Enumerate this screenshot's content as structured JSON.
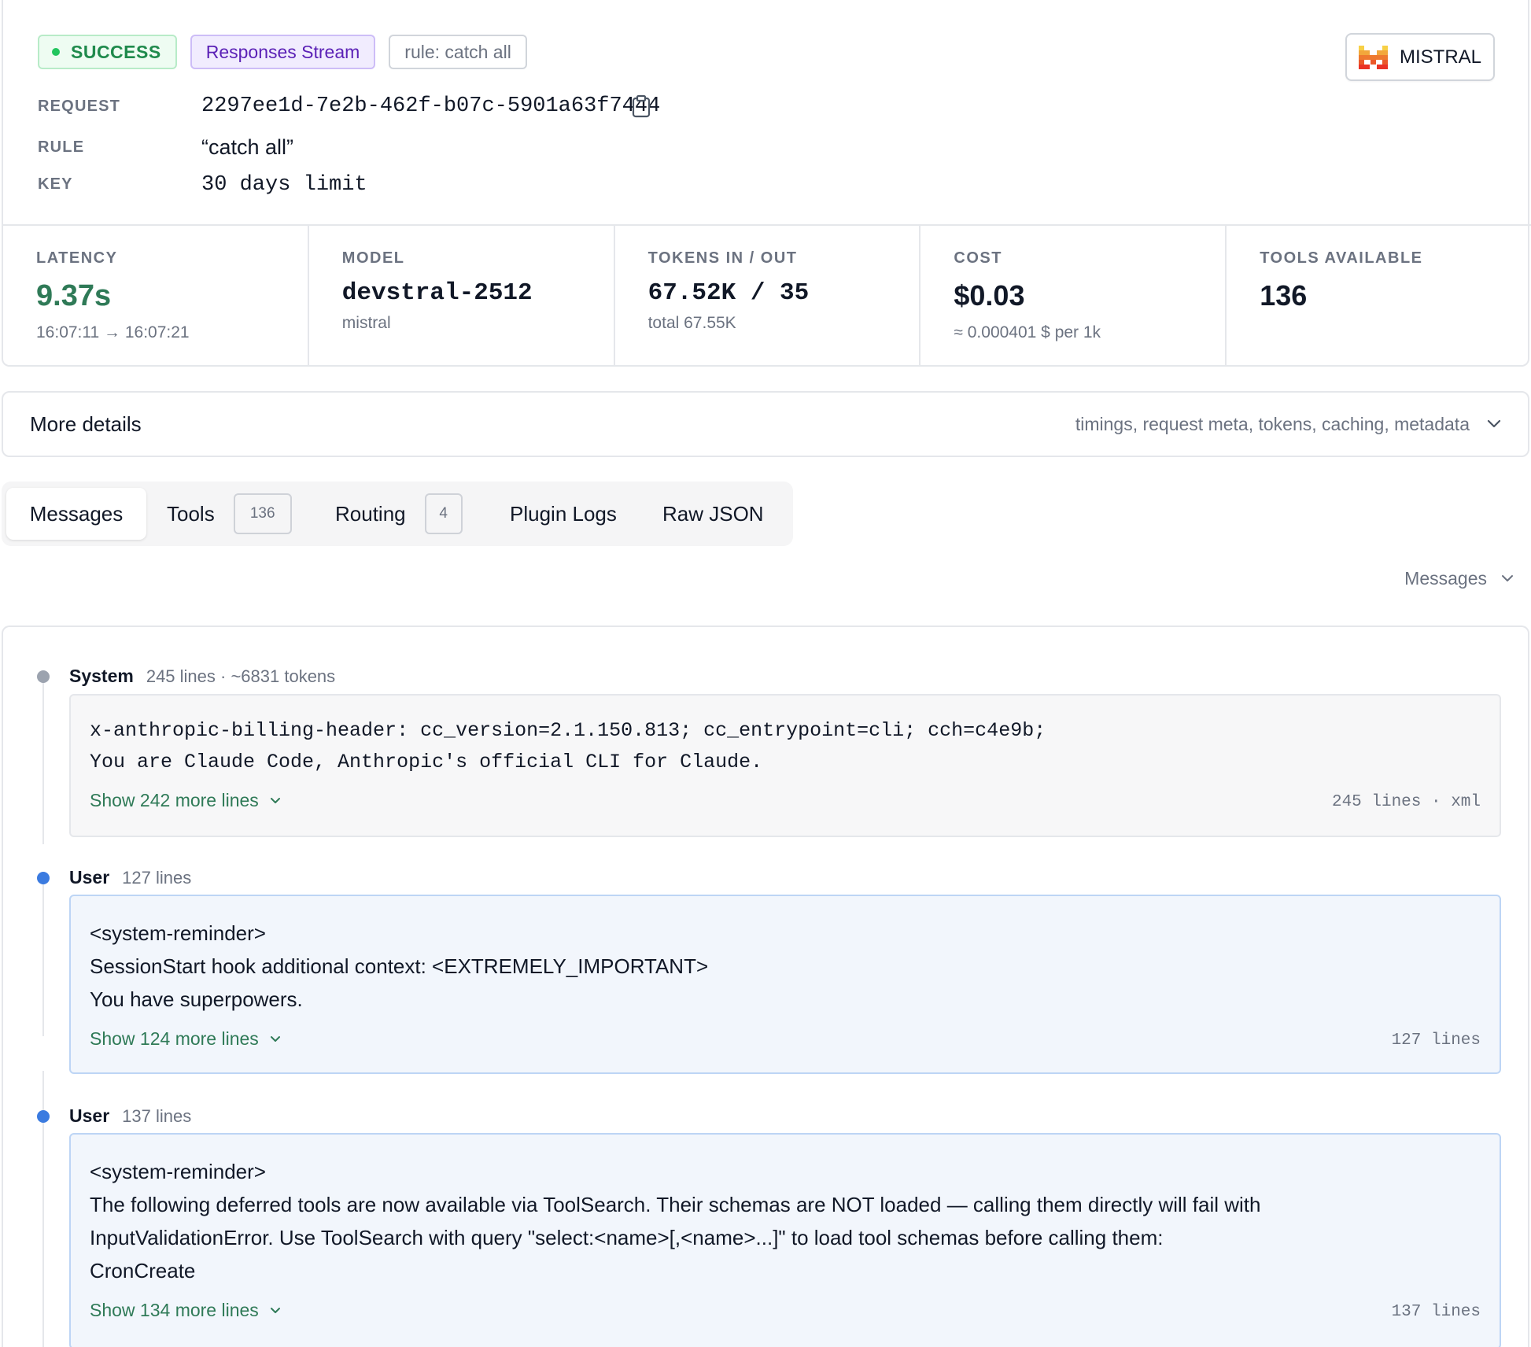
{
  "header": {
    "status": "SUCCESS",
    "stream_type": "Responses Stream",
    "rule_badge": "rule: catch all",
    "provider": "MISTRAL",
    "fields": {
      "request_label": "REQUEST",
      "request_value": "2297ee1d-7e2b-462f-b07c-5901a63f7444",
      "rule_label": "RULE",
      "rule_value": "“catch all”",
      "key_label": "KEY",
      "key_value": "30 days limit"
    }
  },
  "stats": {
    "latency": {
      "label": "LATENCY",
      "value": "9.37s",
      "sub": "16:07:11 → 16:07:21"
    },
    "model": {
      "label": "MODEL",
      "value": "devstral-2512",
      "sub": "mistral"
    },
    "tokens": {
      "label": "TOKENS IN / OUT",
      "value": "67.52K / 35",
      "sub": "total 67.55K"
    },
    "cost": {
      "label": "COST",
      "value": "$0.03",
      "sub": "≈ 0.000401 $  per 1k"
    },
    "tools": {
      "label": "TOOLS AVAILABLE",
      "value": "136"
    }
  },
  "details": {
    "title": "More details",
    "summary": "timings, request meta, tokens, caching, metadata"
  },
  "tabs": {
    "messages": "Messages",
    "tools": "Tools",
    "tools_count": "136",
    "routing": "Routing",
    "routing_count": "4",
    "plugin_logs": "Plugin Logs",
    "raw_json": "Raw JSON"
  },
  "filter": {
    "selected": "Messages"
  },
  "messages": [
    {
      "role": "System",
      "meta": "245 lines · ~6831 tokens",
      "lines": [
        "x-anthropic-billing-header: cc_version=2.1.150.813; cc_entrypoint=cli; cch=c4e9b;",
        "You are Claude Code, Anthropic's official CLI for Claude."
      ],
      "show_more": "Show 242 more lines",
      "footer": "245 lines · xml"
    },
    {
      "role": "User",
      "meta": "127 lines",
      "lines": [
        "<system-reminder>",
        "SessionStart hook additional context: <EXTREMELY_IMPORTANT>",
        "You have superpowers."
      ],
      "show_more": "Show 124 more lines",
      "footer": "127 lines"
    },
    {
      "role": "User",
      "meta": "137 lines",
      "lines": [
        "<system-reminder>",
        "The following deferred tools are now available via ToolSearch. Their schemas are NOT loaded — calling them directly will fail with",
        "InputValidationError. Use ToolSearch with query \"select:<name>[,<name>...]\" to load tool schemas before calling them:",
        "CronCreate"
      ],
      "show_more": "Show 134 more lines",
      "footer": "137 lines"
    }
  ],
  "colors": {
    "success": "#1f8a4c",
    "stream": "#5b21b6",
    "latency_value": "#2f7a57",
    "link": "#2f7a57",
    "system_dot": "#9ca3af",
    "user_dot": "#3b7be0"
  }
}
